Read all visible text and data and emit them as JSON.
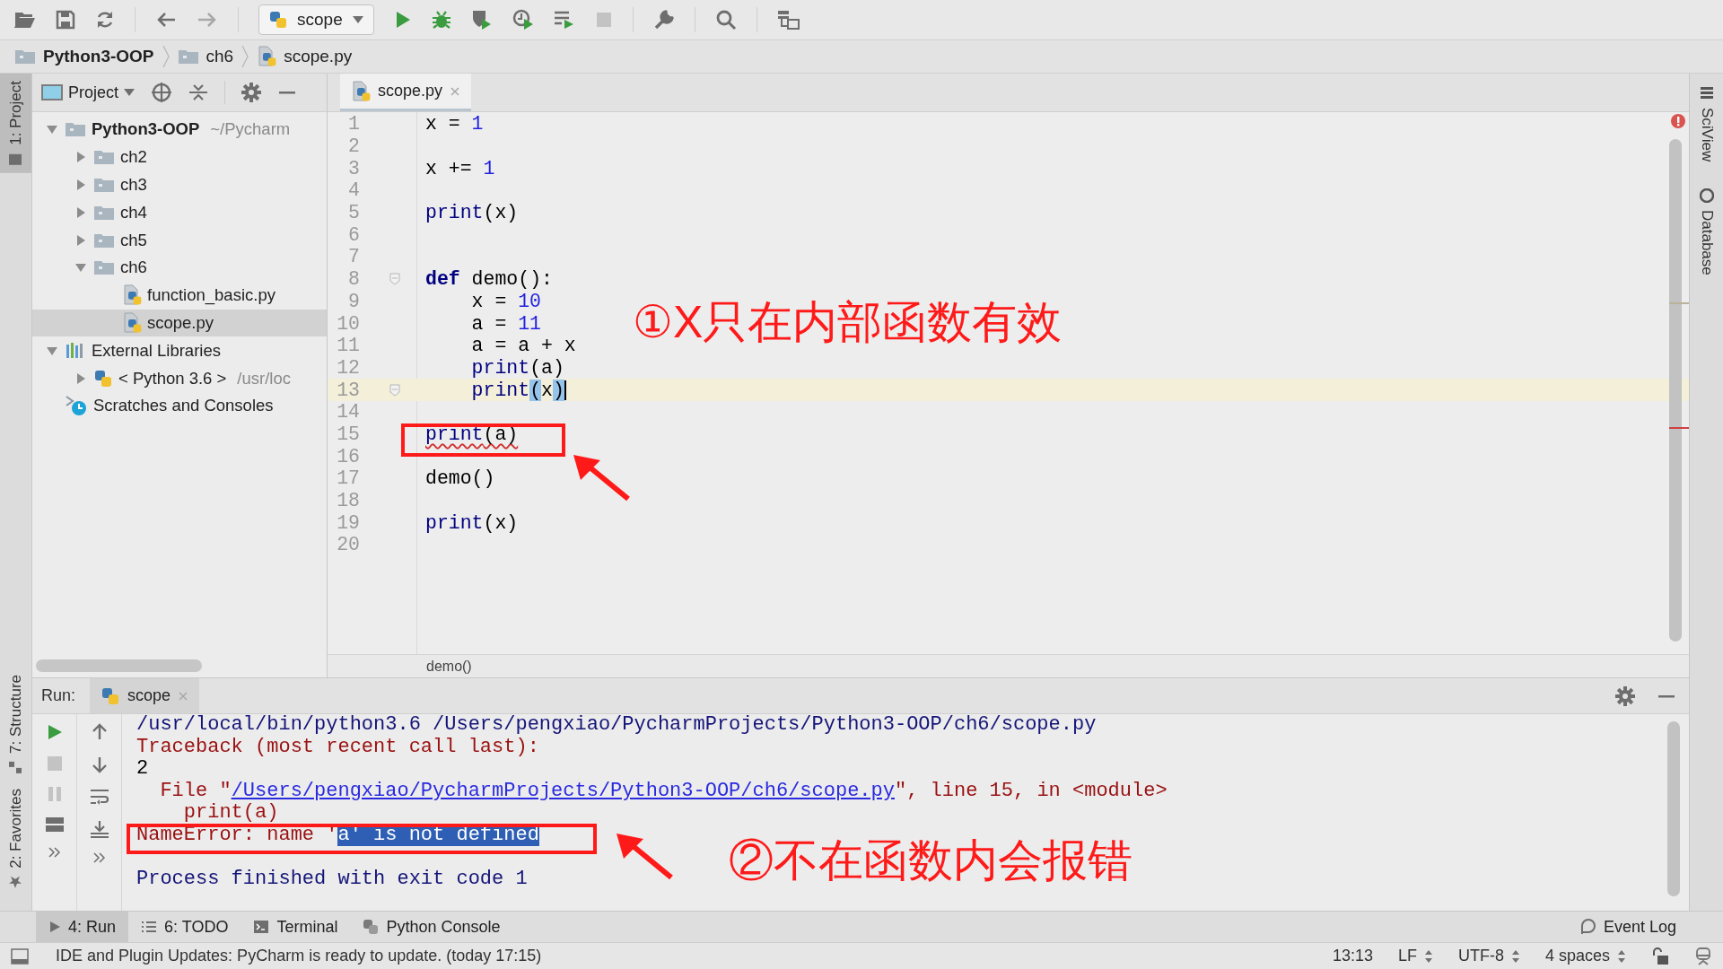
{
  "toolbar": {
    "run_configuration": "scope"
  },
  "breadcrumb": [
    {
      "kind": "project",
      "label": "Python3-OOP"
    },
    {
      "kind": "folder",
      "label": "ch6"
    },
    {
      "kind": "file",
      "label": "scope.py"
    }
  ],
  "left_strip": [
    {
      "label": "1: Project",
      "selected": true
    },
    {
      "label": "7: Structure",
      "selected": false
    },
    {
      "label": "2: Favorites",
      "selected": false
    }
  ],
  "project_panel": {
    "title": "Project",
    "tree": [
      {
        "kind": "project",
        "label": "Python3-OOP",
        "hint": "~/Pycharm",
        "expanded": true,
        "selected": false,
        "children": [
          {
            "kind": "folder",
            "label": "ch2",
            "expanded": false,
            "selected": false
          },
          {
            "kind": "folder",
            "label": "ch3",
            "expanded": false,
            "selected": false
          },
          {
            "kind": "folder",
            "label": "ch4",
            "expanded": false,
            "selected": false
          },
          {
            "kind": "folder",
            "label": "ch5",
            "expanded": false,
            "selected": false
          },
          {
            "kind": "folder",
            "label": "ch6",
            "expanded": true,
            "selected": false,
            "children": [
              {
                "kind": "file",
                "label": "function_basic.py",
                "selected": false
              },
              {
                "kind": "file",
                "label": "scope.py",
                "selected": true
              }
            ]
          }
        ]
      },
      {
        "kind": "library",
        "label": "External Libraries",
        "expanded": true,
        "selected": false,
        "children": [
          {
            "kind": "sdk",
            "label": "< Python 3.6 >",
            "hint": "/usr/loc",
            "expanded": false,
            "selected": false
          }
        ]
      },
      {
        "kind": "scratches",
        "label": "Scratches and Consoles",
        "selected": false
      }
    ]
  },
  "editor": {
    "tabs": [
      {
        "label": "scope.py",
        "selected": true
      }
    ],
    "lines": [
      {
        "number": "1",
        "current": false,
        "fold": false,
        "warning": false,
        "tokens": [
          {
            "kind": "plain",
            "text": "x = "
          },
          {
            "kind": "number",
            "text": "1"
          }
        ]
      },
      {
        "number": "2",
        "current": false,
        "fold": false,
        "warning": false
      },
      {
        "number": "3",
        "current": false,
        "fold": false,
        "warning": false,
        "tokens": [
          {
            "kind": "plain",
            "text": "x += "
          },
          {
            "kind": "number",
            "text": "1"
          }
        ]
      },
      {
        "number": "4",
        "current": false,
        "fold": false,
        "warning": false
      },
      {
        "number": "5",
        "current": false,
        "fold": false,
        "warning": false,
        "tokens": [
          {
            "kind": "builtin",
            "text": "print"
          },
          {
            "kind": "plain",
            "text": "(x)"
          }
        ]
      },
      {
        "number": "6",
        "current": false,
        "fold": false,
        "warning": false
      },
      {
        "number": "7",
        "current": false,
        "fold": false,
        "warning": false
      },
      {
        "number": "8",
        "current": false,
        "fold": true,
        "warning": false,
        "tokens": [
          {
            "kind": "keyword",
            "text": "def"
          },
          {
            "kind": "plain",
            "text": " demo():"
          }
        ]
      },
      {
        "number": "9",
        "current": false,
        "fold": false,
        "warning": false,
        "tokens": [
          {
            "kind": "plain",
            "text": "    x = "
          },
          {
            "kind": "number",
            "text": "10"
          }
        ]
      },
      {
        "number": "10",
        "current": false,
        "fold": false,
        "warning": false,
        "tokens": [
          {
            "kind": "plain",
            "text": "    a = "
          },
          {
            "kind": "number",
            "text": "11"
          }
        ]
      },
      {
        "number": "11",
        "current": false,
        "fold": false,
        "warning": false,
        "tokens": [
          {
            "kind": "plain",
            "text": "    a = a + x"
          }
        ]
      },
      {
        "number": "12",
        "current": false,
        "fold": false,
        "warning": false,
        "tokens": [
          {
            "kind": "builtin",
            "text": "    print"
          },
          {
            "kind": "plain",
            "text": "(a)"
          }
        ]
      },
      {
        "number": "13",
        "current": true,
        "fold": true,
        "warning": false,
        "tokens": [
          {
            "kind": "builtin",
            "text": "    print"
          },
          {
            "kind": "brace_match",
            "text": "("
          },
          {
            "kind": "plain",
            "text": "x"
          },
          {
            "kind": "brace_match",
            "text": ")"
          }
        ]
      },
      {
        "number": "14",
        "current": false,
        "fold": false,
        "warning": false
      },
      {
        "number": "15",
        "current": false,
        "fold": false,
        "warning": true,
        "tokens": [
          {
            "kind": "builtin",
            "text": "print"
          },
          {
            "kind": "plain",
            "text": "(a)"
          }
        ]
      },
      {
        "number": "16",
        "current": false,
        "fold": false,
        "warning": false
      },
      {
        "number": "17",
        "current": false,
        "fold": false,
        "warning": false,
        "tokens": [
          {
            "kind": "plain",
            "text": "demo()"
          }
        ]
      },
      {
        "number": "18",
        "current": false,
        "fold": false,
        "warning": false
      },
      {
        "number": "19",
        "current": false,
        "fold": false,
        "warning": false,
        "tokens": [
          {
            "kind": "builtin",
            "text": "print"
          },
          {
            "kind": "plain",
            "text": "(x)"
          }
        ]
      },
      {
        "number": "20",
        "current": false,
        "fold": false,
        "warning": false
      }
    ],
    "breadcrumb": "demo()"
  },
  "annotations": [
    {
      "note": "①X只在内部函数有效"
    },
    {
      "note": "②不在函数内会报错"
    }
  ],
  "run_panel": {
    "title": "Run:",
    "tabs": [
      {
        "label": "scope",
        "selected": true
      }
    ],
    "console": [
      {
        "kind": "command",
        "segments": [
          {
            "kind": "plain",
            "text": "/usr/local/bin/python3.6 /Users/pengxiao/PycharmProjects/Python3-OOP/ch6/scope.py"
          }
        ]
      },
      {
        "kind": "error",
        "segments": [
          {
            "kind": "plain",
            "text": "Traceback (most recent call last):"
          }
        ]
      },
      {
        "kind": "output",
        "segments": [
          {
            "kind": "plain",
            "text": "2"
          }
        ]
      },
      {
        "kind": "error",
        "segments": [
          {
            "kind": "plain",
            "text": "  File \""
          },
          {
            "kind": "link",
            "text": "/Users/pengxiao/PycharmProjects/Python3-OOP/ch6/scope.py"
          },
          {
            "kind": "plain",
            "text": "\", line 15, in <module>"
          }
        ]
      },
      {
        "kind": "error",
        "segments": [
          {
            "kind": "plain",
            "text": "    print(a)"
          }
        ]
      },
      {
        "kind": "error",
        "segments": [
          {
            "kind": "plain",
            "text": "NameError: name '"
          },
          {
            "kind": "selected",
            "text": "a' is not defined"
          }
        ]
      },
      {
        "kind": "blank"
      },
      {
        "kind": "command",
        "segments": [
          {
            "kind": "plain",
            "text": "Process finished with exit code 1"
          }
        ]
      }
    ]
  },
  "tool_windows": [
    {
      "label": "4: Run",
      "kind": "run",
      "selected": true
    },
    {
      "label": "6: TODO",
      "kind": "todo",
      "selected": false
    },
    {
      "label": "Terminal",
      "kind": "terminal",
      "selected": false
    },
    {
      "label": "Python Console",
      "kind": "python",
      "selected": false
    }
  ],
  "event_log": "Event Log",
  "status_bar": {
    "message": "IDE and Plugin Updates: PyCharm is ready to update. (today 17:15)",
    "position": "13:13",
    "line_separator": "LF",
    "encoding": "UTF-8",
    "indent": "4 spaces"
  },
  "right_strip": [
    "SciView",
    "Database"
  ]
}
